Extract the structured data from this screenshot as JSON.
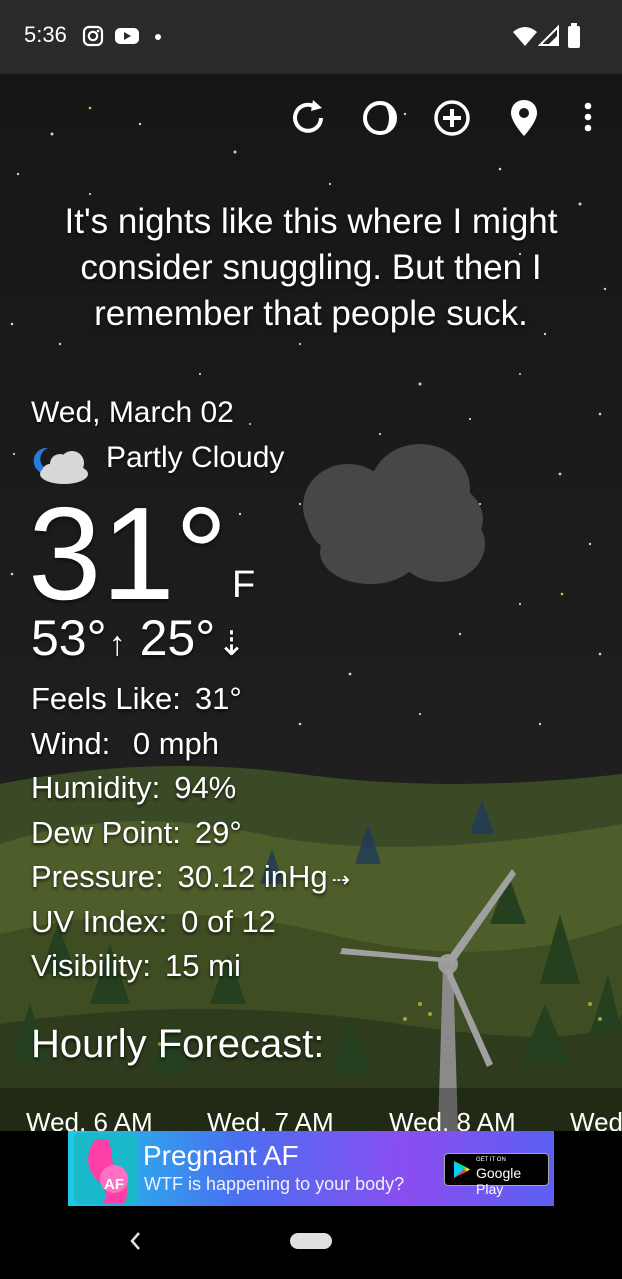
{
  "status_bar": {
    "time": "5:36",
    "left_icons": [
      "instagram-icon",
      "youtube-icon",
      "notification-dot-icon"
    ],
    "right_icons": [
      "wifi-icon",
      "signal-icon",
      "battery-icon"
    ]
  },
  "toolbar": {
    "icons": [
      "refresh-icon",
      "theme-icon",
      "add-location-icon",
      "location-pin-icon",
      "more-vert-icon"
    ]
  },
  "quote": "It's nights like this where I might consider snuggling. But then I remember that people suck.",
  "weather": {
    "date": "Wed, March 02",
    "condition": "Partly Cloudy",
    "condition_icon": "partly-cloudy-night-icon",
    "temperature": "31°",
    "unit": "F",
    "high": "53°",
    "high_arrow": "↑",
    "low": "25°",
    "low_arrow": "⇣"
  },
  "details": [
    {
      "label": "Feels Like:",
      "value": "31°"
    },
    {
      "label": "Wind:",
      "value": " 0 mph"
    },
    {
      "label": "Humidity:",
      "value": "94%"
    },
    {
      "label": "Dew Point:",
      "value": "29°"
    },
    {
      "label": "Pressure:",
      "value": "30.12 inHg"
    },
    {
      "label": "UV Index:",
      "value": "0 of 12"
    },
    {
      "label": "Visibility:",
      "value": "15 mi"
    }
  ],
  "pressure_trend": "⇢",
  "hourly": {
    "title": "Hourly Forecast:",
    "items": [
      "Wed, 6 AM",
      "Wed, 7 AM",
      "Wed, 8 AM",
      "Wed"
    ]
  },
  "ad": {
    "title": "Pregnant AF",
    "subtitle": "WTF is happening to your body?",
    "logo_text": "AF",
    "badge_small": "GET IT ON",
    "badge_big": "Google Play"
  },
  "colors": {
    "status_bar": "#2a2a2a",
    "sky": "#1a1a1a",
    "text": "#ffffff"
  }
}
